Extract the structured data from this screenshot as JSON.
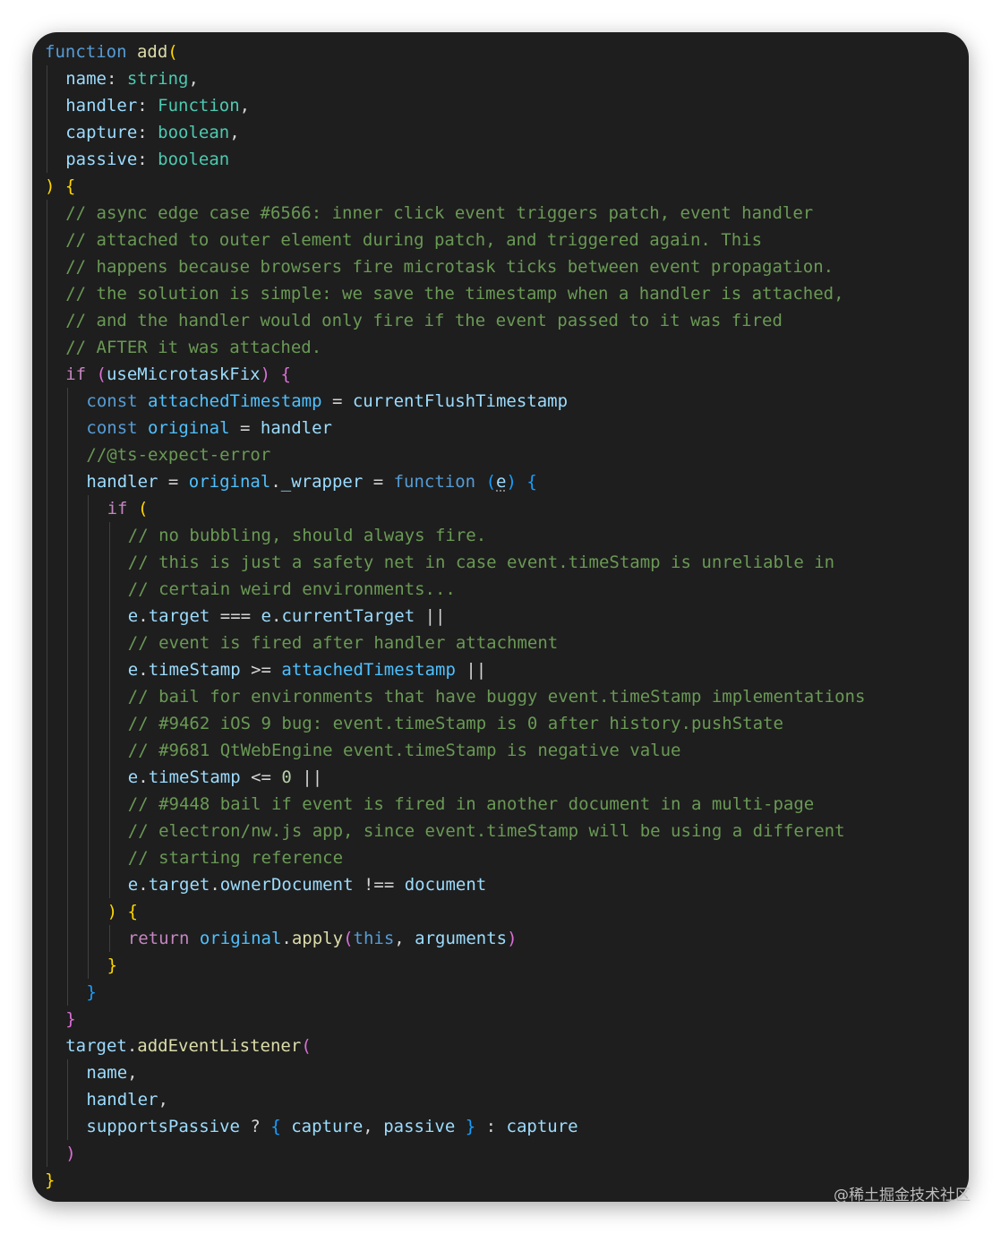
{
  "editor": {
    "theme": "dark",
    "background": "#1e1e1e",
    "lines": [
      {
        "indent": 0,
        "tokens": [
          [
            "function",
            "kw"
          ],
          [
            " ",
            ""
          ],
          [
            "add",
            "fn"
          ],
          [
            "(",
            "b1"
          ]
        ]
      },
      {
        "indent": 1,
        "tokens": [
          [
            "name",
            "var"
          ],
          [
            ": ",
            ""
          ],
          [
            "string",
            "typ"
          ],
          [
            ",",
            ""
          ]
        ]
      },
      {
        "indent": 1,
        "tokens": [
          [
            "handler",
            "var"
          ],
          [
            ": ",
            ""
          ],
          [
            "Function",
            "typ"
          ],
          [
            ",",
            ""
          ]
        ]
      },
      {
        "indent": 1,
        "tokens": [
          [
            "capture",
            "var"
          ],
          [
            ": ",
            ""
          ],
          [
            "boolean",
            "typ"
          ],
          [
            ",",
            ""
          ]
        ]
      },
      {
        "indent": 1,
        "tokens": [
          [
            "passive",
            "var"
          ],
          [
            ": ",
            ""
          ],
          [
            "boolean",
            "typ"
          ]
        ]
      },
      {
        "indent": 0,
        "tokens": [
          [
            ")",
            "b1"
          ],
          [
            " ",
            ""
          ],
          [
            "{",
            "b1"
          ]
        ]
      },
      {
        "indent": 1,
        "tokens": [
          [
            "// async edge case #6566: inner click event triggers patch, event handler",
            "cmt"
          ]
        ]
      },
      {
        "indent": 1,
        "tokens": [
          [
            "// attached to outer element during patch, and triggered again. This",
            "cmt"
          ]
        ]
      },
      {
        "indent": 1,
        "tokens": [
          [
            "// happens because browsers fire microtask ticks between event propagation.",
            "cmt"
          ]
        ]
      },
      {
        "indent": 1,
        "tokens": [
          [
            "// the solution is simple: we save the timestamp when a handler is attached,",
            "cmt"
          ]
        ]
      },
      {
        "indent": 1,
        "tokens": [
          [
            "// and the handler would only fire if the event passed to it was fired",
            "cmt"
          ]
        ]
      },
      {
        "indent": 1,
        "tokens": [
          [
            "// AFTER it was attached.",
            "cmt"
          ]
        ]
      },
      {
        "indent": 1,
        "tokens": [
          [
            "if",
            "ctl"
          ],
          [
            " ",
            ""
          ],
          [
            "(",
            "b2"
          ],
          [
            "useMicrotaskFix",
            "var"
          ],
          [
            ")",
            "b2"
          ],
          [
            " ",
            ""
          ],
          [
            "{",
            "b2"
          ]
        ]
      },
      {
        "indent": 2,
        "tokens": [
          [
            "const",
            "kw"
          ],
          [
            " ",
            ""
          ],
          [
            "attachedTimestamp",
            "cst"
          ],
          [
            " = ",
            ""
          ],
          [
            "currentFlushTimestamp",
            "var"
          ]
        ]
      },
      {
        "indent": 2,
        "tokens": [
          [
            "const",
            "kw"
          ],
          [
            " ",
            ""
          ],
          [
            "original",
            "cst"
          ],
          [
            " = ",
            ""
          ],
          [
            "handler",
            "var"
          ]
        ]
      },
      {
        "indent": 2,
        "tokens": [
          [
            "//@ts-expect-error",
            "cmt"
          ]
        ]
      },
      {
        "indent": 2,
        "tokens": [
          [
            "handler",
            "var"
          ],
          [
            " = ",
            ""
          ],
          [
            "original",
            "cst"
          ],
          [
            ".",
            ""
          ],
          [
            "_wrapper",
            "var"
          ],
          [
            " = ",
            ""
          ],
          [
            "function",
            "kw"
          ],
          [
            " ",
            ""
          ],
          [
            "(",
            "b3"
          ],
          [
            "e",
            "var squig"
          ],
          [
            ")",
            "b3"
          ],
          [
            " ",
            ""
          ],
          [
            "{",
            "b3"
          ]
        ]
      },
      {
        "indent": 3,
        "tokens": [
          [
            "if",
            "ctl"
          ],
          [
            " ",
            ""
          ],
          [
            "(",
            "b1"
          ]
        ]
      },
      {
        "indent": 4,
        "tokens": [
          [
            "// no bubbling, should always fire.",
            "cmt"
          ]
        ]
      },
      {
        "indent": 4,
        "tokens": [
          [
            "// this is just a safety net in case event.timeStamp is unreliable in",
            "cmt"
          ]
        ]
      },
      {
        "indent": 4,
        "tokens": [
          [
            "// certain weird environments...",
            "cmt"
          ]
        ]
      },
      {
        "indent": 4,
        "tokens": [
          [
            "e",
            "var"
          ],
          [
            ".",
            ""
          ],
          [
            "target",
            "var"
          ],
          [
            " === ",
            ""
          ],
          [
            "e",
            "var"
          ],
          [
            ".",
            ""
          ],
          [
            "currentTarget",
            "var"
          ],
          [
            " ||",
            ""
          ]
        ]
      },
      {
        "indent": 4,
        "tokens": [
          [
            "// event is fired after handler attachment",
            "cmt"
          ]
        ]
      },
      {
        "indent": 4,
        "tokens": [
          [
            "e",
            "var"
          ],
          [
            ".",
            ""
          ],
          [
            "timeStamp",
            "var"
          ],
          [
            " >= ",
            ""
          ],
          [
            "attachedTimestamp",
            "cst"
          ],
          [
            " ||",
            ""
          ]
        ]
      },
      {
        "indent": 4,
        "tokens": [
          [
            "// bail for environments that have buggy event.timeStamp implementations",
            "cmt"
          ]
        ]
      },
      {
        "indent": 4,
        "tokens": [
          [
            "// #9462 iOS 9 bug: event.timeStamp is 0 after history.pushState",
            "cmt"
          ]
        ]
      },
      {
        "indent": 4,
        "tokens": [
          [
            "// #9681 QtWebEngine event.timeStamp is negative value",
            "cmt"
          ]
        ]
      },
      {
        "indent": 4,
        "tokens": [
          [
            "e",
            "var"
          ],
          [
            ".",
            ""
          ],
          [
            "timeStamp",
            "var"
          ],
          [
            " <= ",
            ""
          ],
          [
            "0",
            "num"
          ],
          [
            " ||",
            ""
          ]
        ]
      },
      {
        "indent": 4,
        "tokens": [
          [
            "// #9448 bail if event is fired in another document in a multi-page",
            "cmt"
          ]
        ]
      },
      {
        "indent": 4,
        "tokens": [
          [
            "// electron/nw.js app, since event.timeStamp will be using a different",
            "cmt"
          ]
        ]
      },
      {
        "indent": 4,
        "tokens": [
          [
            "// starting reference",
            "cmt"
          ]
        ]
      },
      {
        "indent": 4,
        "tokens": [
          [
            "e",
            "var"
          ],
          [
            ".",
            ""
          ],
          [
            "target",
            "var"
          ],
          [
            ".",
            ""
          ],
          [
            "ownerDocument",
            "var"
          ],
          [
            " !== ",
            ""
          ],
          [
            "document",
            "var"
          ]
        ]
      },
      {
        "indent": 3,
        "tokens": [
          [
            ")",
            "b1"
          ],
          [
            " ",
            ""
          ],
          [
            "{",
            "b1"
          ]
        ]
      },
      {
        "indent": 4,
        "tokens": [
          [
            "return",
            "ctl"
          ],
          [
            " ",
            ""
          ],
          [
            "original",
            "cst"
          ],
          [
            ".",
            ""
          ],
          [
            "apply",
            "fn"
          ],
          [
            "(",
            "b2"
          ],
          [
            "this",
            "kw"
          ],
          [
            ", ",
            ""
          ],
          [
            "arguments",
            "var"
          ],
          [
            ")",
            "b2"
          ]
        ]
      },
      {
        "indent": 3,
        "tokens": [
          [
            "}",
            "b1"
          ]
        ]
      },
      {
        "indent": 2,
        "tokens": [
          [
            "}",
            "b3"
          ]
        ]
      },
      {
        "indent": 1,
        "tokens": [
          [
            "}",
            "b2"
          ]
        ]
      },
      {
        "indent": 1,
        "tokens": [
          [
            "target",
            "var"
          ],
          [
            ".",
            ""
          ],
          [
            "addEventListener",
            "fn"
          ],
          [
            "(",
            "b2"
          ]
        ]
      },
      {
        "indent": 2,
        "tokens": [
          [
            "name",
            "var"
          ],
          [
            ",",
            ""
          ]
        ]
      },
      {
        "indent": 2,
        "tokens": [
          [
            "handler",
            "var"
          ],
          [
            ",",
            ""
          ]
        ]
      },
      {
        "indent": 2,
        "tokens": [
          [
            "supportsPassive",
            "var"
          ],
          [
            " ? ",
            ""
          ],
          [
            "{",
            "b3"
          ],
          [
            " ",
            ""
          ],
          [
            "capture",
            "var"
          ],
          [
            ", ",
            ""
          ],
          [
            "passive",
            "var"
          ],
          [
            " ",
            ""
          ],
          [
            "}",
            "b3"
          ],
          [
            " : ",
            ""
          ],
          [
            "capture",
            "var"
          ]
        ]
      },
      {
        "indent": 1,
        "tokens": [
          [
            ")",
            "b2"
          ]
        ]
      },
      {
        "indent": 0,
        "tokens": [
          [
            "}",
            "b1"
          ]
        ]
      }
    ]
  },
  "watermark": "@稀土掘金技术社区"
}
